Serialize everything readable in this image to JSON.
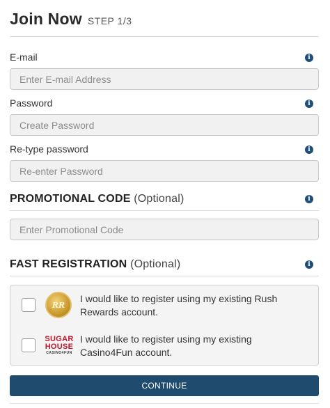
{
  "header": {
    "title": "Join Now",
    "step": "STEP 1/3"
  },
  "fields": {
    "email": {
      "label": "E-mail",
      "placeholder": "Enter E-mail Address",
      "value": ""
    },
    "password": {
      "label": "Password",
      "placeholder": "Create Password",
      "value": ""
    },
    "retype": {
      "label": "Re-type password",
      "placeholder": "Re-enter Password",
      "value": ""
    }
  },
  "promo": {
    "title": "PROMOTIONAL CODE",
    "optional": "(Optional)",
    "placeholder": "Enter Promotional Code",
    "value": ""
  },
  "fast": {
    "title": "FAST REGISTRATION",
    "optional": "(Optional)",
    "options": [
      {
        "text": "I would like to register using my existing Rush Rewards account.",
        "logo_text": "RR",
        "checked": false
      },
      {
        "text": "I would like to register using my existing Casino4Fun account.",
        "logo_lines": [
          "SUGAR",
          "HOUSE",
          "CASINO4FUN"
        ],
        "checked": false
      }
    ]
  },
  "info_icon": "i",
  "continue_label": "CONTINUE",
  "colors": {
    "primary": "#1e4b6e",
    "info": "#1f4e79",
    "sugar_red": "#c0162b"
  }
}
